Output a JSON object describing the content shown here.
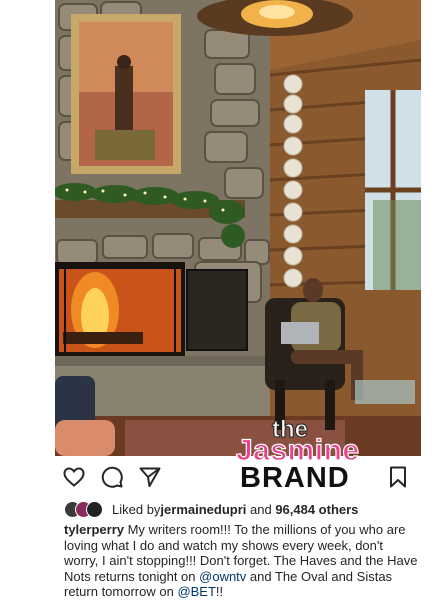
{
  "post": {
    "photo_alt": "",
    "watermark": {
      "line1": "the",
      "line2": "Jasmine",
      "line3": "BRAND"
    }
  },
  "actions": {
    "like_icon": "heart-icon",
    "comment_icon": "comment-icon",
    "share_icon": "share-icon",
    "save_icon": "bookmark-icon"
  },
  "likes": {
    "prefix": "Liked by ",
    "user": "jermainedupri",
    "middle": " and ",
    "others": "96,484 others"
  },
  "caption": {
    "username": "tylerperry",
    "text1": " My writers room!!! To the millions of you who are loving what I do and watch my shows every week, don't worry, I ain't stopping!!! Don't forget. The Haves and the Have Nots returns tonight on ",
    "mention1": "@owntv",
    "text2": " and The Oval and Sistas return tomorrow on ",
    "mention2": "@BET",
    "text3": "!!"
  },
  "colors": {
    "accent_link": "#00376b",
    "text": "#262626",
    "brand_pink": "#e8418a"
  }
}
